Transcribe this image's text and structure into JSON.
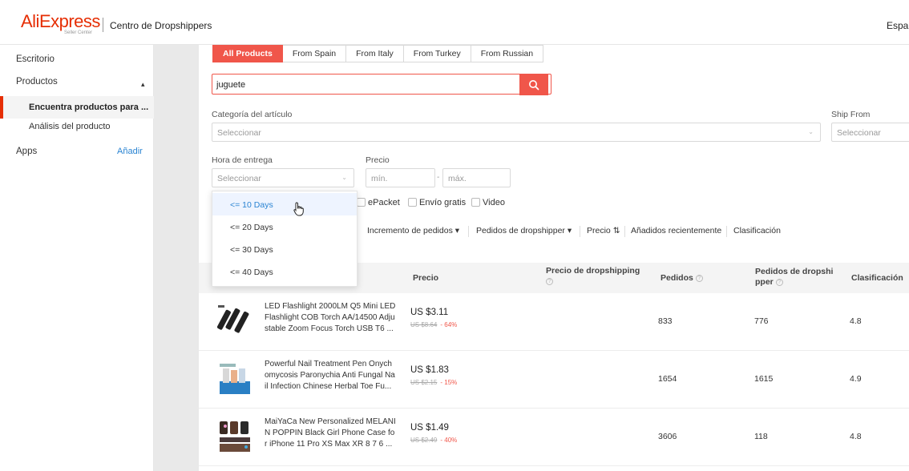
{
  "header": {
    "logo": "AliExpress",
    "logo_sub": "Seller Center",
    "title": "Centro de Dropshippers",
    "language": "Espa"
  },
  "sidebar": {
    "items": [
      {
        "label": "Escritorio"
      },
      {
        "label": "Productos",
        "expanded": true
      },
      {
        "label": "Encuentra productos para ...",
        "active": true
      },
      {
        "label": "Análisis del producto"
      },
      {
        "label": "Apps",
        "action": "Añadir"
      }
    ]
  },
  "tabs": [
    "All Products",
    "From Spain",
    "From Italy",
    "From Turkey",
    "From Russian"
  ],
  "search": {
    "value": "juguete"
  },
  "filters": {
    "category_label": "Categoría del artículo",
    "category_placeholder": "Seleccionar",
    "ship_from_label": "Ship From",
    "ship_from_placeholder": "Seleccionar",
    "delivery_label": "Hora de entrega",
    "delivery_placeholder": "Seleccionar",
    "price_label": "Precio",
    "price_min_placeholder": "mín.",
    "price_max_placeholder": "máx.",
    "checkboxes": [
      "ePacket",
      "Envío gratis",
      "Video"
    ]
  },
  "delivery_dropdown": {
    "options": [
      "<= 10 Days",
      "<= 20 Days",
      "<= 30 Days",
      "<= 40 Days"
    ],
    "hovered_index": 0
  },
  "sort": {
    "items": [
      "Incremento de pedidos",
      "Pedidos de dropshipper",
      "Precio",
      "Añadidos recientemente",
      "Clasificación"
    ]
  },
  "table": {
    "columns": {
      "price": "Precio",
      "dropship_price": "Precio de dropshipping",
      "orders": "Pedidos",
      "dropshipper_orders_1": "Pedidos de dropshi",
      "dropshipper_orders_2": "pper",
      "rating": "Clasificación"
    },
    "rows": [
      {
        "name_lines": [
          "LED Flashlight 2000LM Q5 Mini LED",
          "Flashlight COB Torch AA/14500 Adju",
          "stable Zoom Focus Torch USB T6 ..."
        ],
        "price": "US $3.11",
        "old_price": "US $8.64",
        "discount": "- 64%",
        "orders": "833",
        "dropshipper_orders": "776",
        "rating": "4.8"
      },
      {
        "name_lines": [
          "Powerful Nail Treatment Pen Onych",
          "omycosis Paronychia Anti Fungal Na",
          "il Infection Chinese Herbal Toe Fu..."
        ],
        "price": "US $1.83",
        "old_price": "US $2.15",
        "discount": "- 15%",
        "orders": "1654",
        "dropshipper_orders": "1615",
        "rating": "4.9"
      },
      {
        "name_lines": [
          "MaiYaCa New Personalized MELANI",
          "N POPPIN Black Girl Phone Case fo",
          "r iPhone 11 Pro XS Max XR 8 7 6 ..."
        ],
        "price": "US $1.49",
        "old_price": "US $2.49",
        "discount": "- 40%",
        "orders": "3606",
        "dropshipper_orders": "118",
        "rating": "4.8"
      }
    ]
  },
  "colors": {
    "accent": "#f0564a",
    "brand": "#e62e04",
    "link": "#2a84d2"
  }
}
